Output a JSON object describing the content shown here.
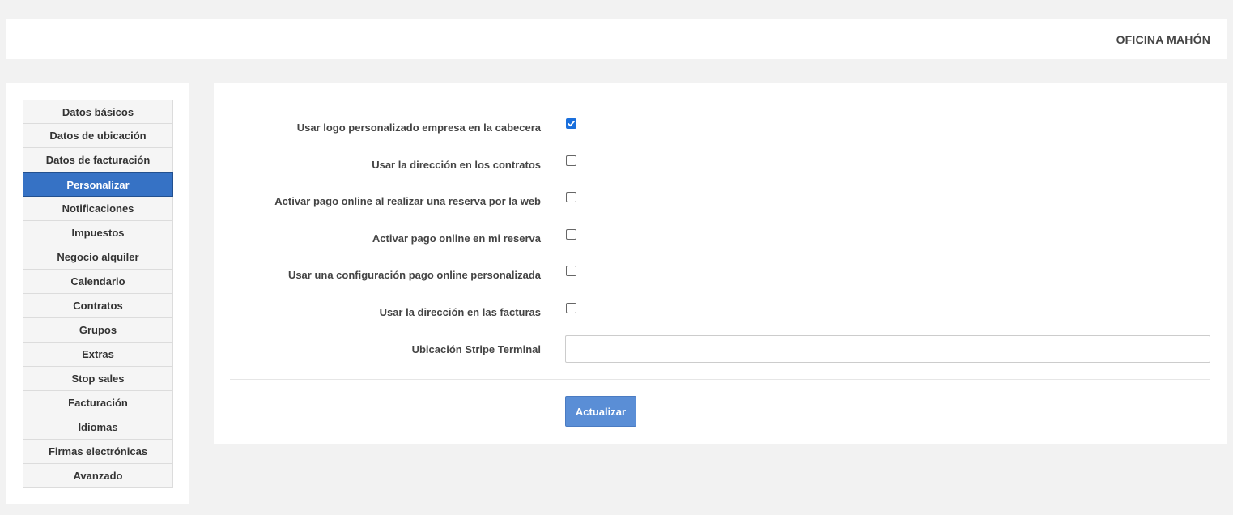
{
  "header": {
    "office_name": "OFICINA MAHÓN"
  },
  "sidebar": {
    "items": [
      {
        "label": "Datos básicos"
      },
      {
        "label": "Datos de ubicación"
      },
      {
        "label": "Datos de facturación"
      },
      {
        "label": "Personalizar",
        "active": true
      },
      {
        "label": "Notificaciones"
      },
      {
        "label": "Impuestos"
      },
      {
        "label": "Negocio alquiler"
      },
      {
        "label": "Calendario"
      },
      {
        "label": "Contratos"
      },
      {
        "label": "Grupos"
      },
      {
        "label": "Extras"
      },
      {
        "label": "Stop sales"
      },
      {
        "label": "Facturación"
      },
      {
        "label": "Idiomas"
      },
      {
        "label": "Firmas electrónicas"
      },
      {
        "label": "Avanzado"
      }
    ]
  },
  "form": {
    "options": [
      {
        "label": "Usar logo personalizado empresa en la cabecera",
        "checked": true
      },
      {
        "label": "Usar la dirección en los contratos",
        "checked": false
      },
      {
        "label": "Activar pago online al realizar una reserva por la web",
        "checked": false
      },
      {
        "label": "Activar pago online en mi reserva",
        "checked": false
      },
      {
        "label": "Usar una configuración pago online personalizada",
        "checked": false
      },
      {
        "label": "Usar la dirección en las facturas",
        "checked": false
      }
    ],
    "stripe_label": "Ubicación Stripe Terminal",
    "stripe_value": "",
    "submit_label": "Actualizar"
  },
  "colors": {
    "accent": "#3672c5",
    "button": "#5a8ed6",
    "checkbox_checked": "#1a6fdc",
    "background": "#f2f2f2"
  }
}
